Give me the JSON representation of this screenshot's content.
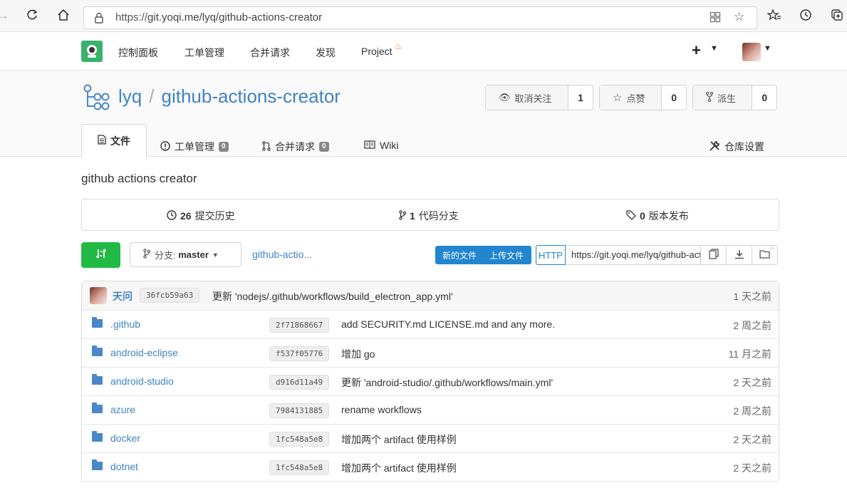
{
  "browser": {
    "url_prefix": "https://",
    "url_rest": "git.yoqi.me/lyq/github-actions-creator"
  },
  "nav": {
    "items": [
      "控制面板",
      "工单管理",
      "合并请求",
      "发现",
      "Project"
    ],
    "plus": "+"
  },
  "repo": {
    "owner": "lyq",
    "name": "github-actions-creator",
    "watch_label": "取消关注",
    "watch_count": "1",
    "star_label": "点赞",
    "star_count": "0",
    "fork_label": "派生",
    "fork_count": "0"
  },
  "tabs": {
    "files": "文件",
    "issues": "工单管理",
    "issues_count": "0",
    "pulls": "合并请求",
    "pulls_count": "0",
    "wiki": "Wiki",
    "settings": "仓库设置"
  },
  "description": "github actions creator",
  "stats": {
    "commits_count": "26",
    "commits_label": "提交历史",
    "branches_count": "1",
    "branches_label": "代码分支",
    "releases_count": "0",
    "releases_label": "版本发布"
  },
  "toolbar": {
    "branch_prefix": "分支:",
    "branch_name": "master",
    "breadcrumb": "github-actio...",
    "new_file": "新的文件",
    "upload_file": "上传文件",
    "protocol": "HTTP",
    "clone_url": "https://git.yoqi.me/lyq/github-actions-creator.git"
  },
  "latest_commit": {
    "author": "天问",
    "sha": "36fcb59a63",
    "message": "更新 'nodejs/.github/workflows/build_electron_app.yml'",
    "age": "1 天之前"
  },
  "files": [
    {
      "name": ".github",
      "sha": "2f71868667",
      "message": "add SECURITY.md LICENSE.md and any more.",
      "age": "2 周之前"
    },
    {
      "name": "android-eclipse",
      "sha": "f537f05776",
      "message": "增加 go",
      "age": "11 月之前"
    },
    {
      "name": "android-studio",
      "sha": "d916d11a49",
      "message": "更新 'android-studio/.github/workflows/main.yml'",
      "age": "2 天之前"
    },
    {
      "name": "azure",
      "sha": "7984131885",
      "message": "rename workflows",
      "age": "2 周之前"
    },
    {
      "name": "docker",
      "sha": "1fc548a5e8",
      "message": "增加两个 artifact 使用样例",
      "age": "2 天之前"
    },
    {
      "name": "dotnet",
      "sha": "1fc548a5e8",
      "message": "增加两个 artifact 使用样例",
      "age": "2 天之前"
    }
  ],
  "colors": {
    "link": "#4183c4",
    "green": "#21ba45",
    "blue": "#2185d0",
    "logo": "#39b36b"
  }
}
